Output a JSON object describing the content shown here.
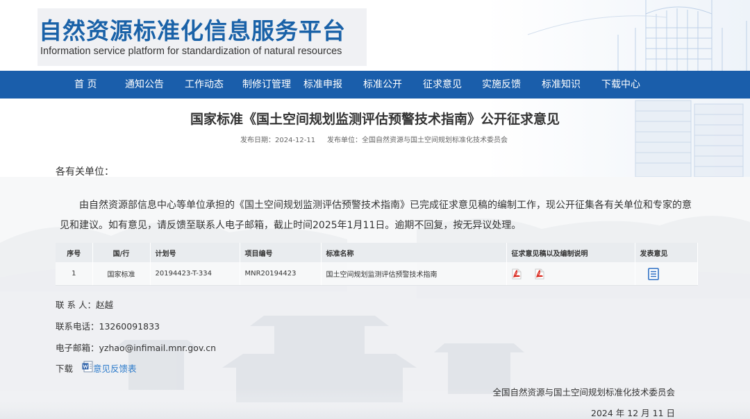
{
  "header": {
    "logo_cn": "自然资源标准化信息服务平台",
    "logo_en": "Information service platform for standardization of natural resources"
  },
  "nav": {
    "items": [
      "首 页",
      "通知公告",
      "工作动态",
      "制修订管理",
      "标准申报",
      "标准公开",
      "征求意见",
      "实施反馈",
      "标准知识",
      "下载中心"
    ]
  },
  "article": {
    "title": "国家标准《国土空间规划监测评估预警技术指南》公开征求意见",
    "publish_date": "发布日期：2024-12-11",
    "publisher": "发布单位：全国自然资源与国土空间规划标准化技术委员会",
    "greeting": "各有关单位：",
    "body": "由自然资源部信息中心等单位承担的《国土空间规划监测评估预警技术指南》已完成征求意见稿的编制工作，现公开征集各有关单位和专家的意见和建议。如有意见，请反馈至联系人电子邮箱，截止时间2025年1月11日。逾期不回复，按无异议处理。"
  },
  "table": {
    "headers": [
      "序号",
      "国/行",
      "计划号",
      "项目编号",
      "标准名称",
      "征求意见稿以及编制说明",
      "发表意见"
    ],
    "rows": [
      {
        "no": "1",
        "level": "国家标准",
        "plan_no": "20194423-T-334",
        "project_no": "MNR20194423",
        "name": "国土空间规划监测评估预警技术指南",
        "files": [
          "pdf-icon",
          "pdf-icon"
        ],
        "comment_icon": "document-list-icon"
      }
    ]
  },
  "contact": {
    "person": "联 系 人：赵越",
    "phone": "联系电话：13260091833",
    "email": "电子邮箱：yzhao@infimail.mnr.gov.cn"
  },
  "download": {
    "label": "下载",
    "icon": "word-document-icon",
    "link": "意见反馈表"
  },
  "signature": {
    "org": "全国自然资源与国土空间规划标准化技术委员会",
    "date": "2024 年 12 月 11 日"
  },
  "colors": {
    "brand_blue": "#1a5eab",
    "link_blue": "#2d7bcb",
    "pdf_red": "#d9261c"
  }
}
